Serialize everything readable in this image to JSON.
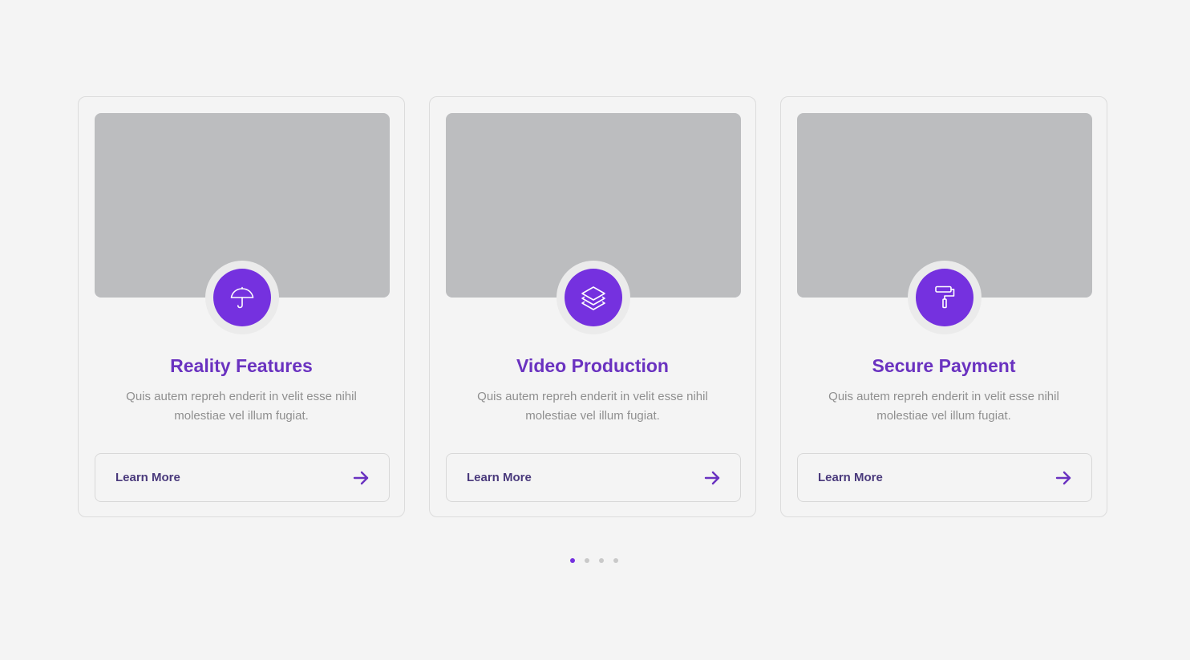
{
  "colors": {
    "accent": "#7531df",
    "title": "#6a32c0",
    "button_text": "#4a3a7c",
    "description": "#8f8f8f",
    "image_placeholder": "#bcbdbf",
    "background": "#f4f4f4"
  },
  "cards": [
    {
      "icon": "umbrella-icon",
      "title": "Reality Features",
      "description": "Quis autem repreh enderit in velit esse nihil molestiae vel illum fugiat.",
      "button_label": "Learn More"
    },
    {
      "icon": "layers-icon",
      "title": "Video Production",
      "description": "Quis autem repreh enderit in velit esse nihil molestiae vel illum fugiat.",
      "button_label": "Learn More"
    },
    {
      "icon": "paint-roller-icon",
      "title": "Secure Payment",
      "description": "Quis autem repreh enderit in velit esse nihil molestiae vel illum fugiat.",
      "button_label": "Learn More"
    }
  ],
  "pagination": {
    "total": 4,
    "active_index": 0
  }
}
